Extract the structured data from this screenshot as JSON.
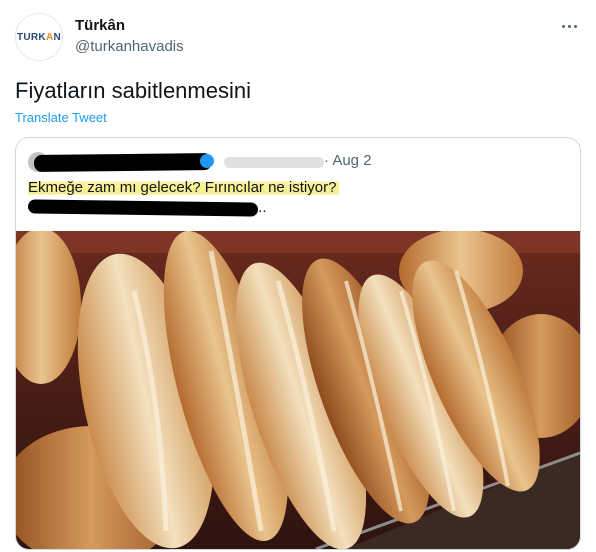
{
  "author": {
    "display_name": "Türkân",
    "handle": "@turkanhavadis",
    "avatar_logo_text": "TURKAN"
  },
  "tweet": {
    "text": "Fiyatların sabitlenmesini",
    "translate_label": "Translate Tweet"
  },
  "quoted": {
    "date": "· Aug 2",
    "headline": "Ekmeğe zam mı gelecek? Fırıncılar ne istiyor?",
    "line2_suffix": "...",
    "image_alt": "Loaves of bread on a bakery rack"
  },
  "colors": {
    "link": "#1d9bf0",
    "secondary_text": "#536471",
    "highlight": "#f8ee8a",
    "border": "#cfd9de"
  }
}
